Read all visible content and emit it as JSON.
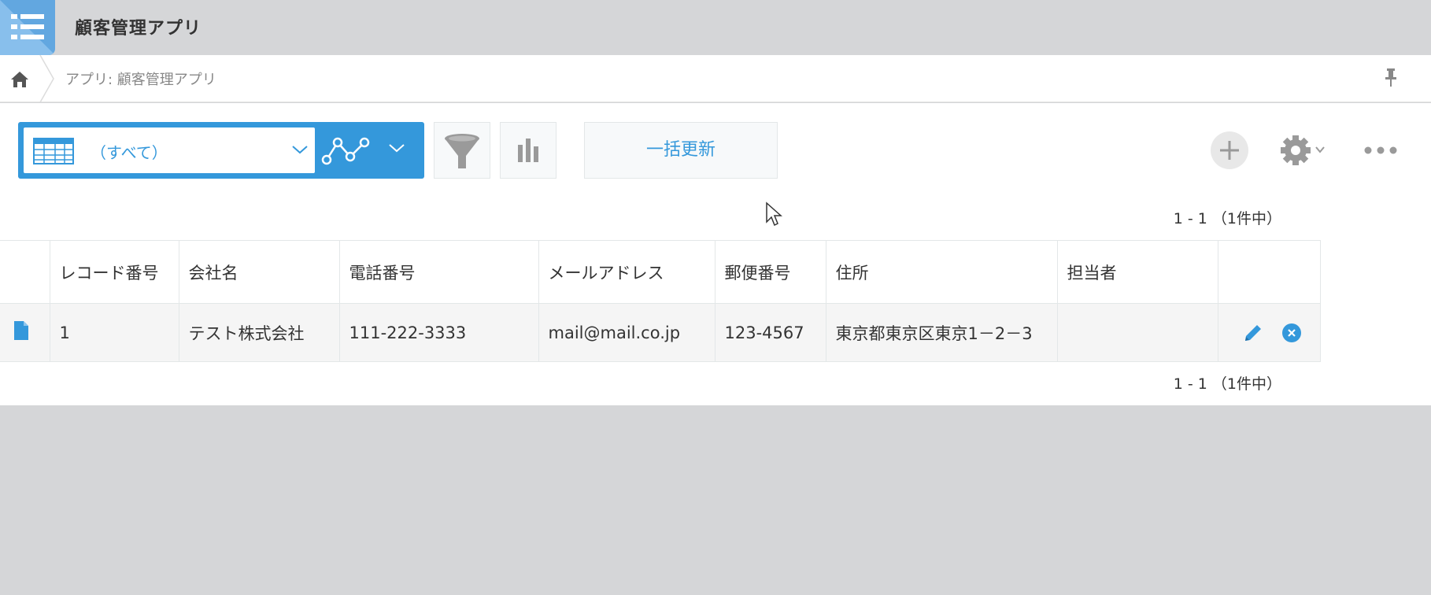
{
  "app": {
    "title": "顧客管理アプリ",
    "icon": "list-icon"
  },
  "breadcrumb": {
    "home_icon": "home-icon",
    "current": "アプリ: 顧客管理アプリ",
    "pin_icon": "pin-icon"
  },
  "toolbar": {
    "view": {
      "icon": "table-view-icon",
      "label": "（すべて）"
    },
    "graph_icon": "graph-icon",
    "filter_icon": "filter-icon",
    "chart_icon": "bar-chart-icon",
    "bulk_update_label": "一括更新",
    "add_icon": "plus-icon",
    "settings_icon": "gear-icon",
    "more_icon": "more-icon"
  },
  "pager": {
    "top": "1 - 1 （1件中）",
    "bottom": "1 - 1 （1件中）"
  },
  "table": {
    "headers": [
      "レコード番号",
      "会社名",
      "電話番号",
      "メールアドレス",
      "郵便番号",
      "住所",
      "担当者"
    ],
    "rows": [
      {
        "record_no": "1",
        "company": "テスト株式会社",
        "phone": "111-222-3333",
        "email": "mail@mail.co.jp",
        "postal": "123-4567",
        "address": "東京都東京区東京1－2－3",
        "owner": ""
      }
    ]
  },
  "colors": {
    "accent": "#3498db",
    "header_bg": "#d5d6d8",
    "app_icon": "#62a7e0",
    "row_bg": "#f5f5f5"
  }
}
